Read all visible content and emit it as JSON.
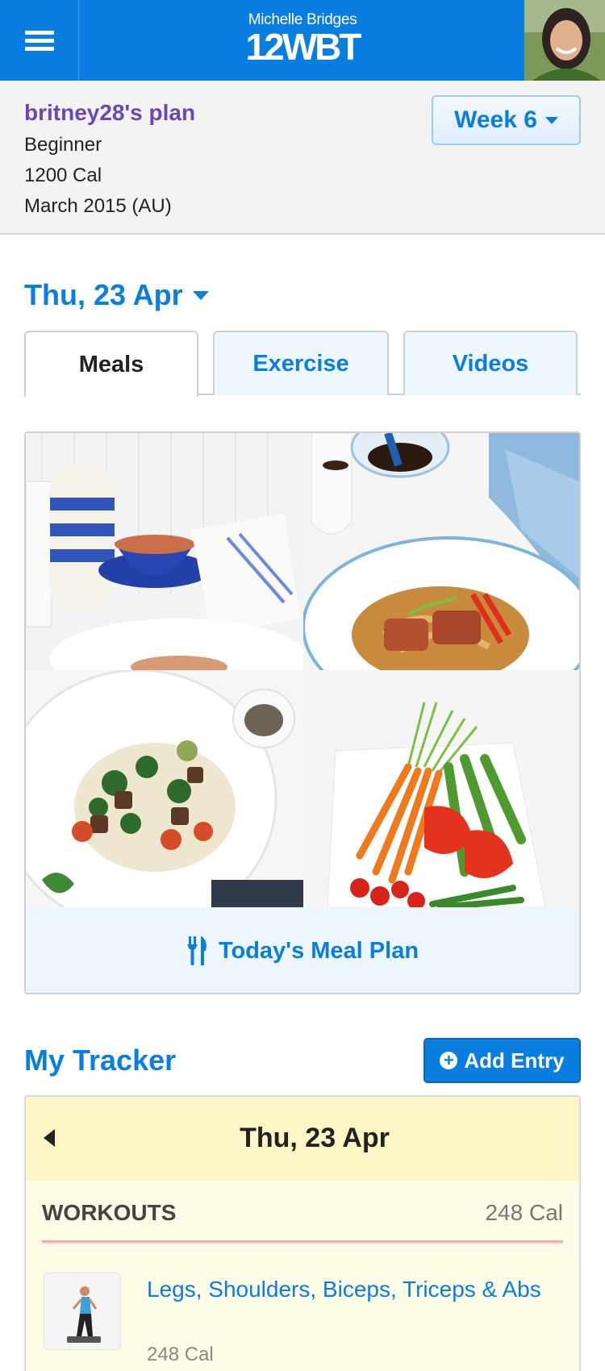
{
  "header": {
    "brand_subtitle": "Michelle Bridges",
    "brand_logo": "12WBT",
    "menu_icon": "hamburger-menu-icon"
  },
  "plan": {
    "name": "britney28's plan",
    "level": "Beginner",
    "calories": "1200 Cal",
    "round": "March 2015 (AU)",
    "week_label": "Week 6"
  },
  "date_selector": {
    "label": "Thu, 23 Apr"
  },
  "tabs": [
    {
      "label": "Meals",
      "active": true
    },
    {
      "label": "Exercise",
      "active": false
    },
    {
      "label": "Videos",
      "active": false
    }
  ],
  "meal_card": {
    "link_label": "Today's Meal Plan",
    "link_icon": "fork-knife-icon"
  },
  "tracker": {
    "title": "My Tracker",
    "add_label": "Add Entry",
    "date": "Thu, 23 Apr",
    "section_label": "WORKOUTS",
    "section_cal": "248 Cal",
    "workout": {
      "name": "Legs, Shoulders, Biceps, Triceps & Abs",
      "cal": "248 Cal"
    }
  },
  "colors": {
    "primary": "#0a7ee0",
    "plan_name": "#6b46b8",
    "tracker_bg": "#fefbe6",
    "tracker_head": "#fcf5c5"
  }
}
